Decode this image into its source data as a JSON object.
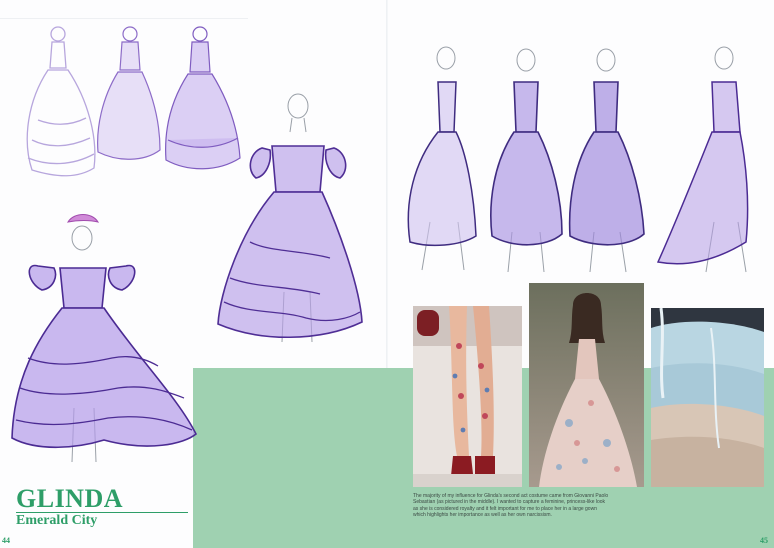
{
  "heading": {
    "title": "GLINDA",
    "subtitle": "Emerald City"
  },
  "caption": "The majority of my influence for Glinda's second act costume came from Giovanni Paolo Sebastian (as pictured in the middle). I wanted to capture a feminine, princess-like look as she is considered royalty and it felt important for me to place her in a large gown which highlights her importance as well as her own narcissism.",
  "page_numbers": {
    "left": "44",
    "right": "45"
  },
  "colors": {
    "accent": "#2e9e68",
    "band": "#9fd1b1",
    "sketch_purple": "#5b3a9c",
    "sketch_lilac": "#a98bd8"
  }
}
